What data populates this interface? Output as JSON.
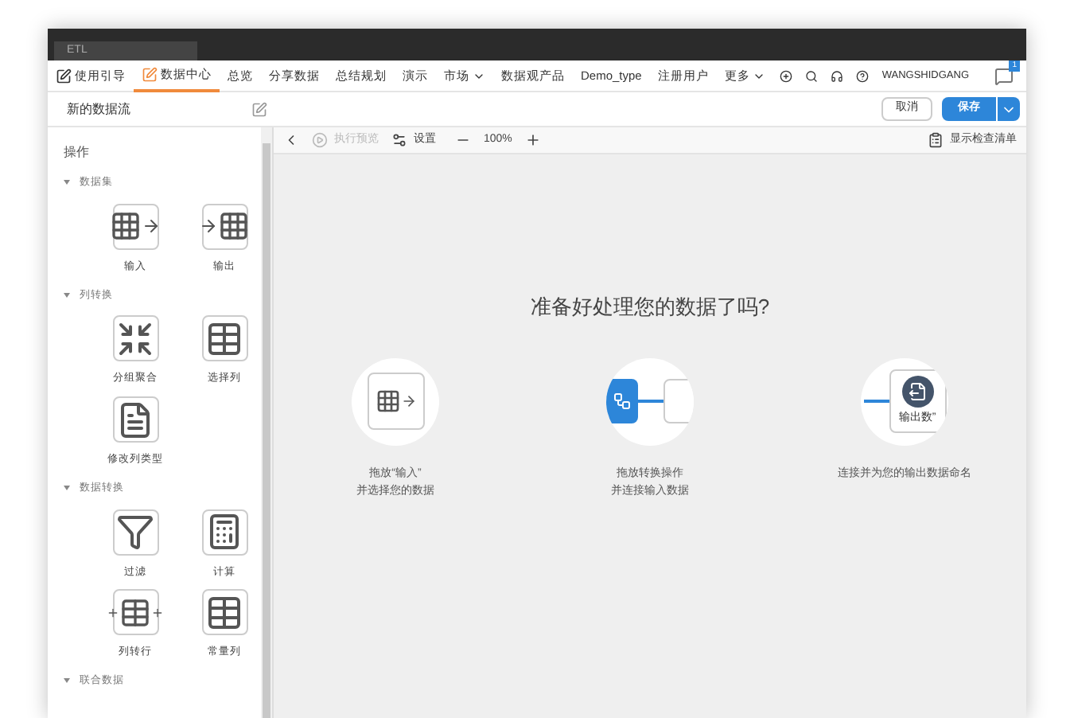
{
  "window": {
    "tab": "ETL"
  },
  "nav": {
    "items": [
      {
        "label": "使用引导",
        "kind": "icon",
        "selected": false
      },
      {
        "label": "数据中心",
        "kind": "icon",
        "selected": true
      },
      {
        "label": "总览",
        "kind": "plain",
        "selected": false
      },
      {
        "label": "分享数据",
        "kind": "plain",
        "selected": false
      },
      {
        "label": "总结规划",
        "kind": "plain",
        "selected": false
      },
      {
        "label": "演示",
        "kind": "plain",
        "selected": false
      },
      {
        "label": "市场",
        "kind": "menu",
        "selected": false
      },
      {
        "label": "数据观产品",
        "kind": "plain",
        "selected": false
      },
      {
        "label": "Demo_type",
        "kind": "plain",
        "selected": false
      },
      {
        "label": "注册用户",
        "kind": "plain",
        "selected": false
      },
      {
        "label": "更多",
        "kind": "menu",
        "selected": false
      }
    ],
    "user": "WANGSHIDGANG",
    "badge": "1"
  },
  "header": {
    "title": "新的数据流",
    "cancel": "取消",
    "save": "保存"
  },
  "sidebar": {
    "title": "操作",
    "groups": [
      {
        "label": "数据集",
        "expanded": true,
        "items": [
          {
            "label": "输入",
            "kind": "input"
          },
          {
            "label": "输出",
            "kind": "output"
          }
        ]
      },
      {
        "label": "列转换",
        "expanded": true,
        "items": [
          {
            "label": "分组聚合",
            "kind": "aggregate"
          },
          {
            "label": "选择列",
            "kind": "select"
          },
          {
            "label": "修改列类型",
            "kind": "type"
          }
        ]
      },
      {
        "label": "数据转换",
        "expanded": true,
        "items": [
          {
            "label": "过滤",
            "kind": "filter"
          },
          {
            "label": "计算",
            "kind": "calc"
          },
          {
            "label": "列转行",
            "kind": "pivot"
          },
          {
            "label": "常量列",
            "kind": "constant"
          }
        ]
      },
      {
        "label": "联合数据",
        "expanded": true
      }
    ]
  },
  "toolbar": {
    "run": "执行预览",
    "run_disabled": true,
    "settings": "设置",
    "zoom": "100%",
    "checklist": "显示检查清单"
  },
  "canvas": {
    "heading": "准备好处理您的数据了吗?",
    "steps": [
      {
        "kind": "input",
        "lines": [
          "拖放“输入”",
          "并选择您的数据"
        ]
      },
      {
        "kind": "transform",
        "lines": [
          "拖放转换操作",
          "并连接输入数据"
        ]
      },
      {
        "kind": "output",
        "node": "输出数”",
        "lines": [
          "连接并为您的输出数据命名"
        ]
      }
    ]
  }
}
